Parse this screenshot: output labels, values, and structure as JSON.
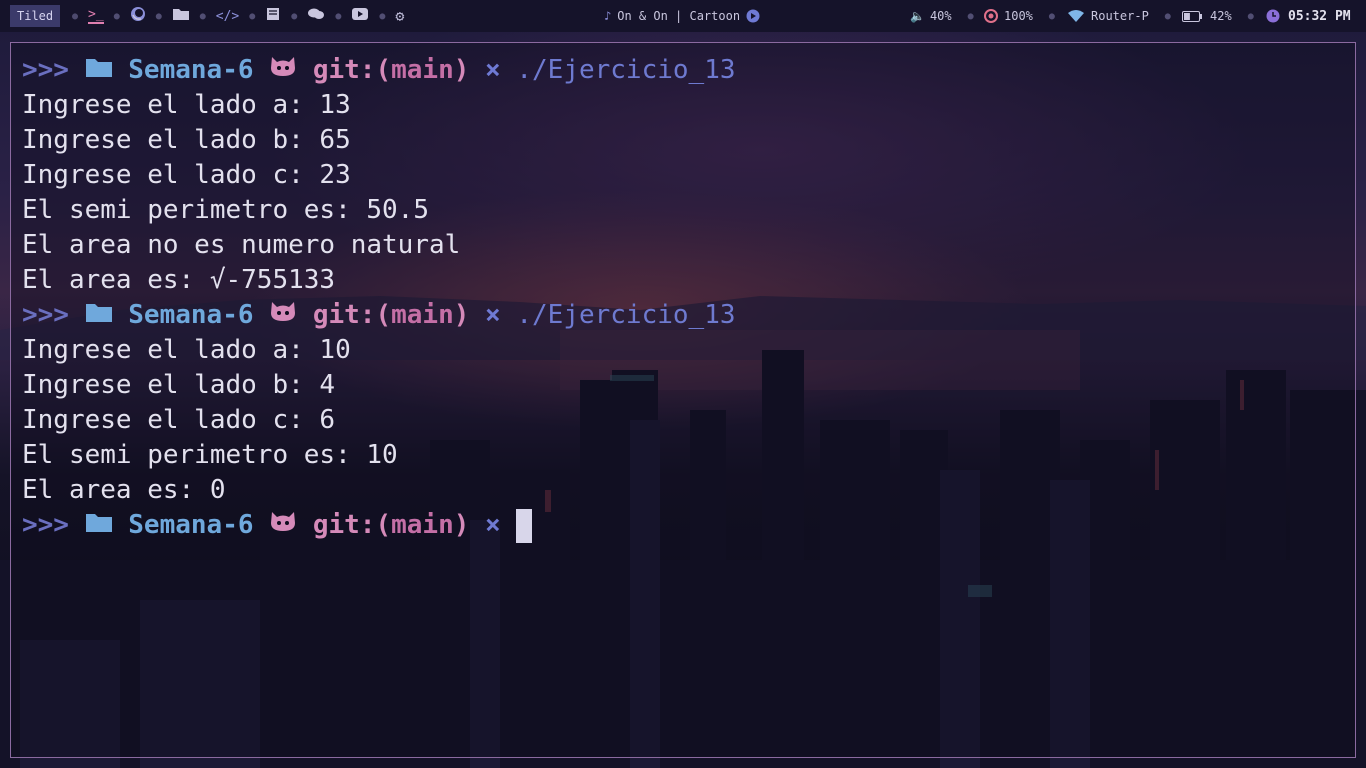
{
  "topbar": {
    "layout": "Tiled",
    "workspaces": [
      {
        "icon": "terminal-icon",
        "active": true
      },
      {
        "icon": "firefox-icon",
        "active": false
      },
      {
        "icon": "folder-icon",
        "active": false
      },
      {
        "icon": "code-icon",
        "active": false
      },
      {
        "icon": "book-icon",
        "active": false
      },
      {
        "icon": "chat-icon",
        "active": false
      },
      {
        "icon": "youtube-icon",
        "active": false
      },
      {
        "icon": "gear-icon",
        "active": false
      }
    ],
    "music": "On & On | Cartoon",
    "volume": "40%",
    "brightness": "100%",
    "network": "Router-P",
    "battery": "42%",
    "clock": "05:32 PM"
  },
  "terminal": {
    "prompt": {
      "arrows": ">>>",
      "dir": "Semana-6",
      "git_label": "git:",
      "branch_open": "(",
      "branch": "main",
      "branch_close": ")",
      "dirty_mark": "×"
    },
    "lines": [
      {
        "type": "prompt",
        "cmd": "./Ejercicio_13"
      },
      {
        "type": "out",
        "text": "Ingrese el lado a: 13"
      },
      {
        "type": "out",
        "text": "Ingrese el lado b: 65"
      },
      {
        "type": "out",
        "text": "Ingrese el lado c: 23"
      },
      {
        "type": "out",
        "text": "El semi perimetro es: 50.5"
      },
      {
        "type": "out",
        "text": "El area no es numero natural"
      },
      {
        "type": "out",
        "text": "El area es: √-755133"
      },
      {
        "type": "prompt",
        "cmd": "./Ejercicio_13"
      },
      {
        "type": "out",
        "text": "Ingrese el lado a: 10"
      },
      {
        "type": "out",
        "text": "Ingrese el lado b: 4"
      },
      {
        "type": "out",
        "text": "Ingrese el lado c: 6"
      },
      {
        "type": "out",
        "text": "El semi perimetro es: 10"
      },
      {
        "type": "out",
        "text": "El area es: 0"
      },
      {
        "type": "prompt",
        "cmd": ""
      }
    ]
  },
  "colors": {
    "accent": "#e07fb0",
    "prompt_dir": "#6fa8dc",
    "prompt_git": "#d58ab9",
    "terminal_border": "#8b6aa0"
  }
}
